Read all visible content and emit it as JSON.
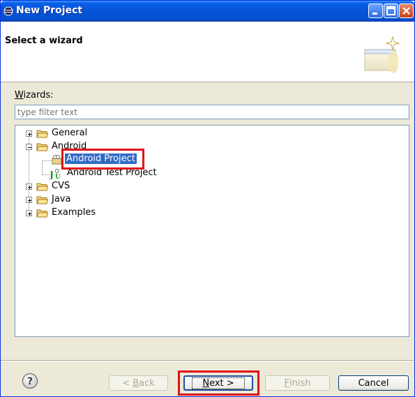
{
  "window": {
    "title": "New Project"
  },
  "banner": {
    "title": "Select a wizard"
  },
  "wizards": {
    "label_prefix": "W",
    "label_rest": "izards:",
    "filter_placeholder": "type filter text"
  },
  "tree": {
    "items": [
      {
        "label": "General",
        "expanded": false
      },
      {
        "label": "Android",
        "expanded": true,
        "children": [
          {
            "label": "Android Project",
            "selected": true
          },
          {
            "label": "Android Test Project"
          }
        ]
      },
      {
        "label": "CVS",
        "expanded": false
      },
      {
        "label": "Java",
        "expanded": false
      },
      {
        "label": "Examples",
        "expanded": false
      }
    ]
  },
  "buttons": {
    "back_prefix": "< ",
    "back_mnemonic": "B",
    "back_rest": "ack",
    "next_mnemonic": "N",
    "next_rest": "ext >",
    "finish_mnemonic": "F",
    "finish_rest": "inish",
    "cancel": "Cancel"
  },
  "colors": {
    "title_bar": "#0553d8",
    "selection": "#316ac5",
    "highlight_box": "#e0101a"
  },
  "icons": [
    "eclipse-icon",
    "minimize-icon",
    "maximize-icon",
    "close-icon",
    "wizard-banner-icon",
    "folder-icon",
    "android-project-icon",
    "junit-icon",
    "help-icon"
  ]
}
